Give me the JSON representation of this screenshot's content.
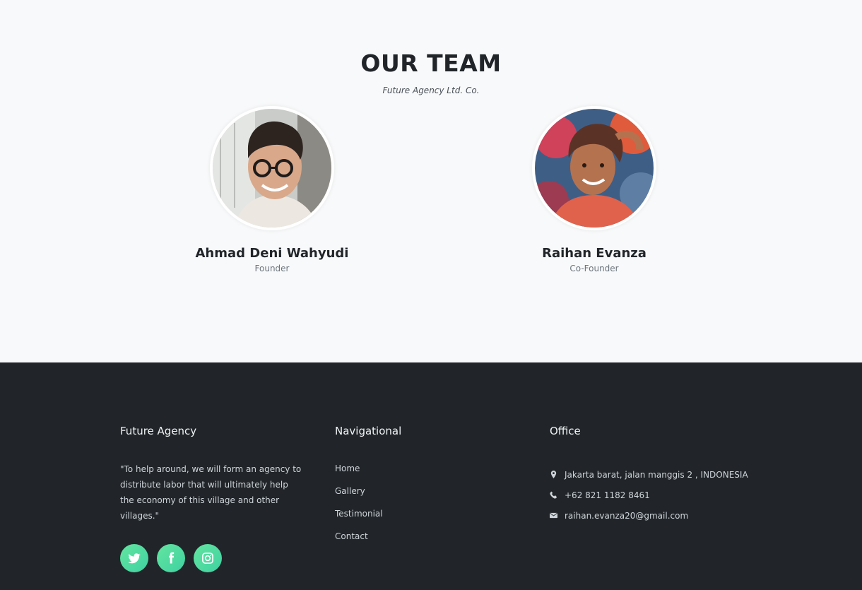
{
  "team": {
    "title": "OUR TEAM",
    "subtitle": "Future Agency Ltd. Co.",
    "members": [
      {
        "name": "Ahmad Deni Wahyudi",
        "role": "Founder"
      },
      {
        "name": "Raihan Evanza",
        "role": "Co-Founder"
      }
    ]
  },
  "footer": {
    "about": {
      "title": "Future Agency",
      "text": "\"To help around, we will form an agency to distribute labor that will ultimately help the economy of this village and other villages.\""
    },
    "social": [
      {
        "icon": "twitter-icon"
      },
      {
        "icon": "facebook-icon"
      },
      {
        "icon": "instagram-icon"
      }
    ],
    "nav": {
      "title": "Navigational",
      "links": [
        "Home",
        "Gallery",
        "Testimonial",
        "Contact"
      ]
    },
    "office": {
      "title": "Office",
      "address": "Jakarta barat, jalan manggis 2 , INDONESIA",
      "phone": "+62 821 1182 8461",
      "email": "raihan.evanza20@gmail.com"
    }
  },
  "colors": {
    "footer_bg": "#212529",
    "page_bg": "#f8f9fa",
    "social_accent": "#4fdc9f"
  }
}
